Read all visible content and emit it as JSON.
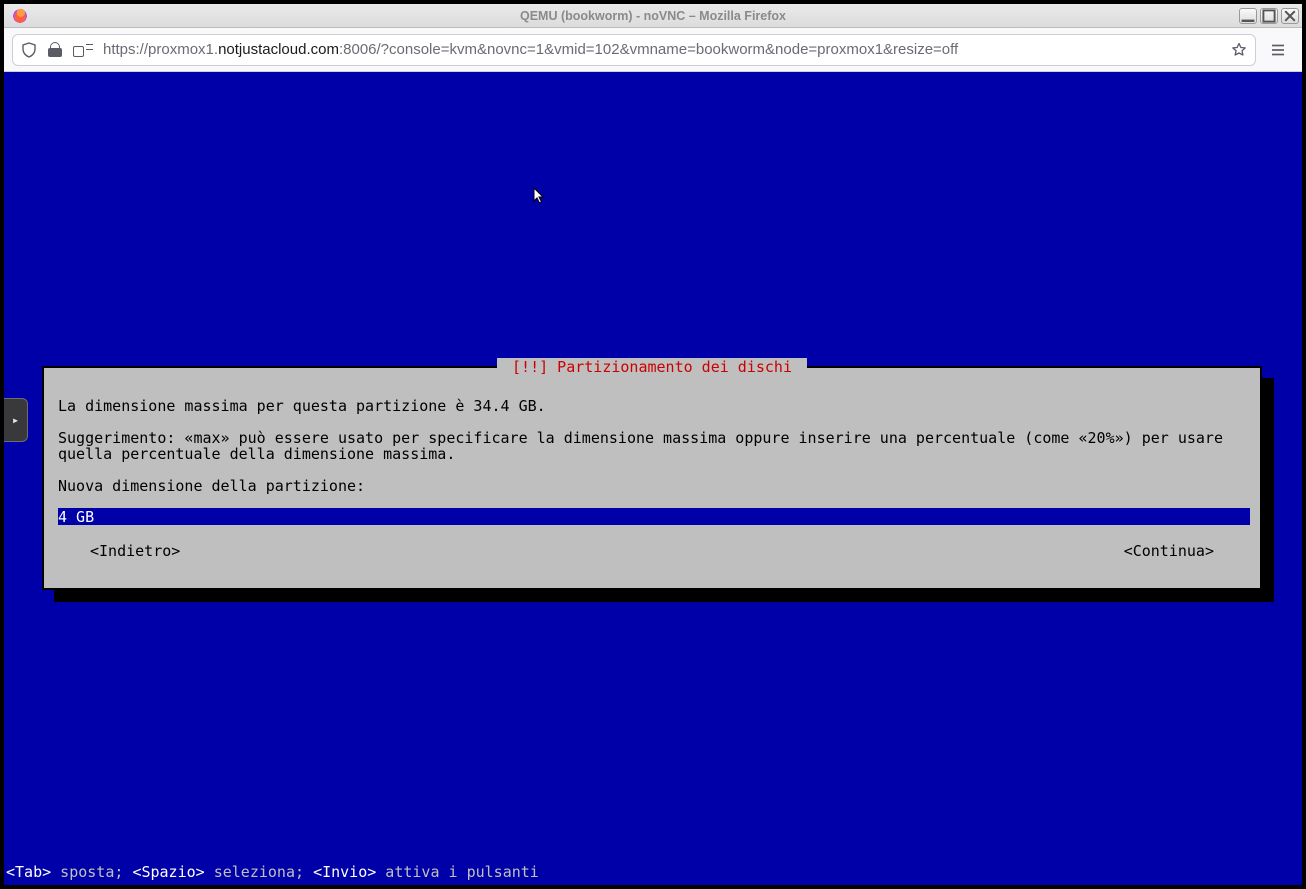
{
  "window": {
    "title": "QEMU (bookworm) - noVNC – Mozilla Firefox"
  },
  "addressbar": {
    "scheme": "https://",
    "sub": "proxmox1.",
    "host": "notjustacloud.com",
    "port_and_path": ":8006/?console=kvm&novnc=1&vmid=102&vmname=bookworm&node=proxmox1&resize=off"
  },
  "novnc": {
    "handle_glyph": "▸"
  },
  "dialog": {
    "title": "[!!] Partizionamento dei dischi",
    "line1": "La dimensione massima per questa partizione è 34.4 GB.",
    "line2": "Suggerimento: «max» può essere usato per specificare la dimensione massima oppure inserire una percentuale (come «20%») per usare quella percentuale della dimensione massima.",
    "prompt": "Nuova dimensione della partizione:",
    "input_value": "4 GB",
    "back": "<Indietro>",
    "cont": "<Continua>"
  },
  "help": {
    "tab": "<Tab>",
    "tab_txt": " sposta; ",
    "space": "<Spazio>",
    "space_txt": " seleziona; ",
    "enter": "<Invio>",
    "enter_txt": " attiva i pulsanti"
  }
}
